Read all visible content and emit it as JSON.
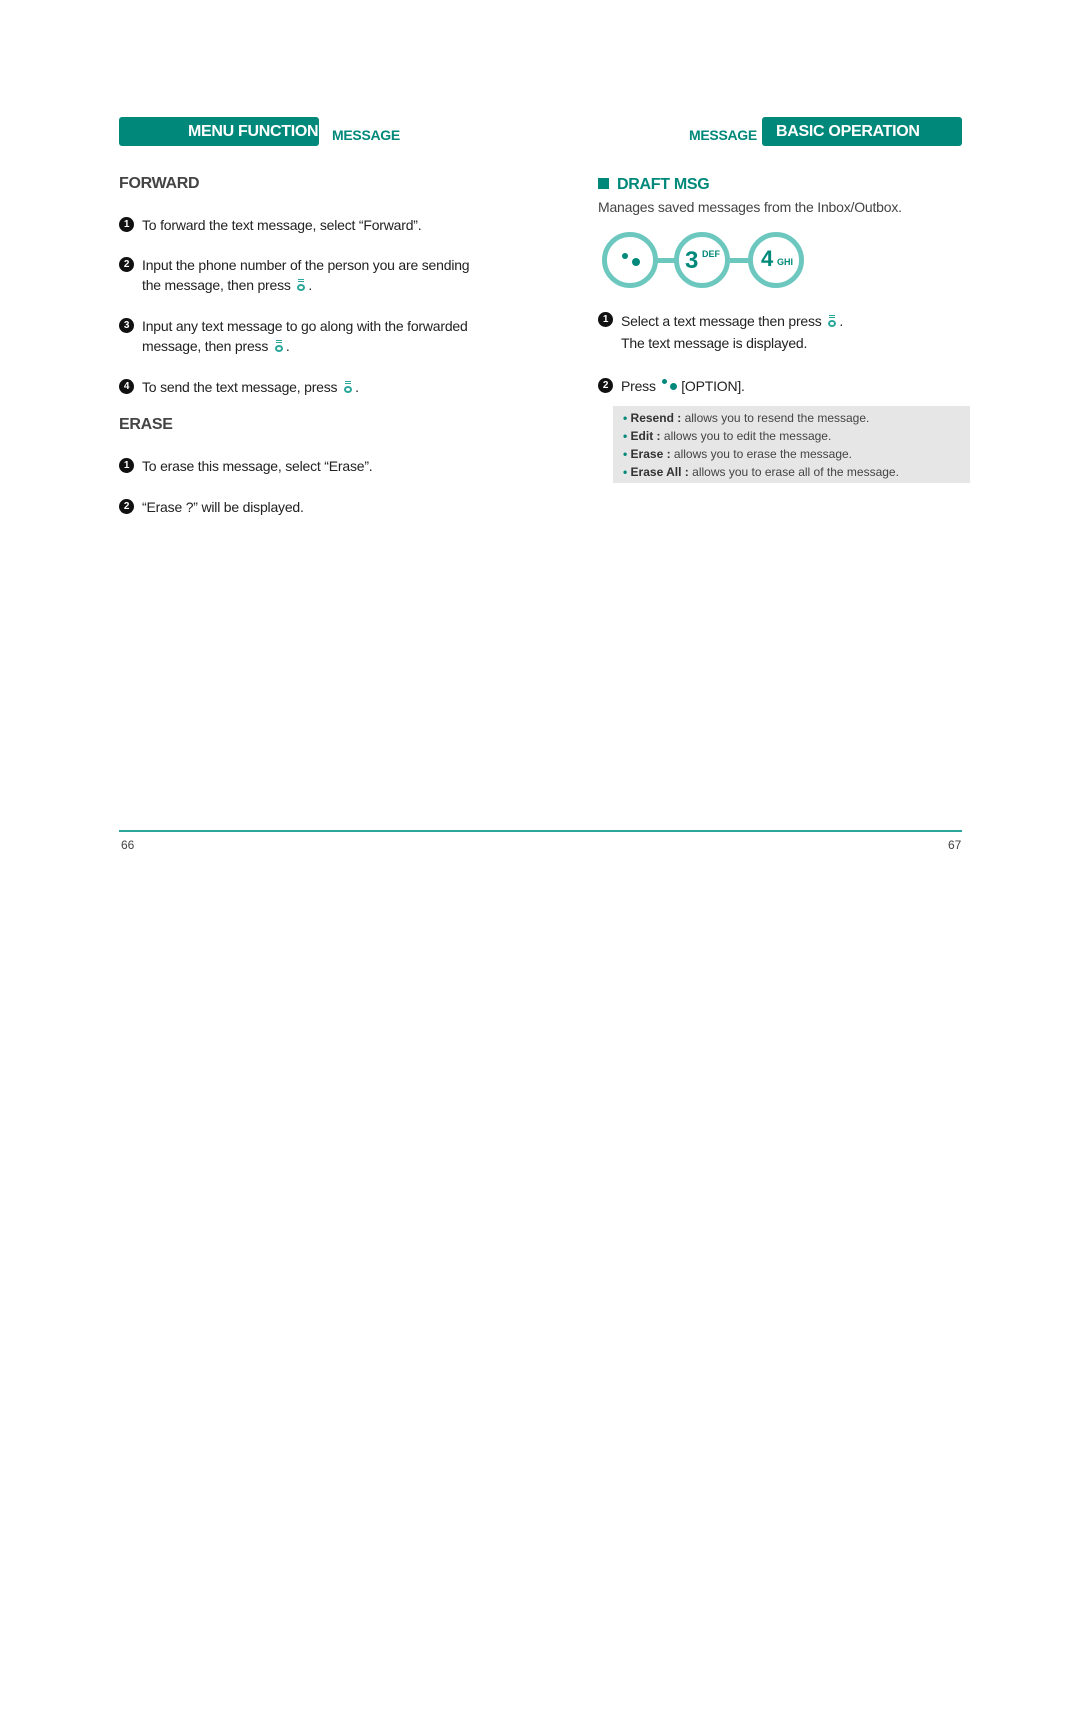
{
  "header": {
    "left_tab": "MENU FUNCTION",
    "left_sub": "MESSAGE",
    "right_sub": "MESSAGE",
    "right_tab": "BASIC OPERATION",
    "accent_color": "#00897a"
  },
  "left_page": {
    "forward": {
      "title": "FORWARD",
      "steps": [
        {
          "num": "1",
          "text": "To forward the text message, select “Forward”."
        },
        {
          "num": "2",
          "line1": "Input the phone number of the person you are sending",
          "line2": "the message, then press",
          "icon": "ok-key-icon",
          "end": "."
        },
        {
          "num": "3",
          "line1": "Input any text message to go along with the forwarded",
          "line2": "message, then press",
          "icon": "ok-key-icon",
          "end": "."
        },
        {
          "num": "4",
          "text": "To send the text message, press",
          "icon": "ok-key-icon",
          "end": "."
        }
      ]
    },
    "erase": {
      "title": "ERASE",
      "steps": [
        {
          "num": "1",
          "text": "To erase this message, select “Erase”."
        },
        {
          "num": "2",
          "text": "“Erase ?” will be displayed."
        }
      ]
    },
    "page_number": "66"
  },
  "right_page": {
    "draft": {
      "title": "DRAFT MSG",
      "description": "Manages saved messages from the Inbox/Outbox.",
      "key_sequence": [
        {
          "icon": "menu-dots-key-icon",
          "label": ""
        },
        {
          "icon": "key-3",
          "label": "3",
          "letters": "DEF"
        },
        {
          "icon": "key-4",
          "label": "4",
          "letters": "GHI"
        }
      ],
      "steps": [
        {
          "num": "1",
          "line1": "Select a text message then press",
          "icon": "ok-key-icon",
          "end": ".",
          "line2": "The text message is displayed."
        },
        {
          "num": "2",
          "text_before": "Press",
          "icon": "menu-dots-icon",
          "text_after": "[OPTION]."
        }
      ],
      "options": [
        {
          "name": "Resend :",
          "desc": "allows you to resend the message."
        },
        {
          "name": "Edit :",
          "desc": "allows you to edit the message."
        },
        {
          "name": "Erase :",
          "desc": "allows you to erase the message."
        },
        {
          "name": "Erase All :",
          "desc": "allows you to erase all of the message."
        }
      ]
    },
    "page_number": "67"
  }
}
